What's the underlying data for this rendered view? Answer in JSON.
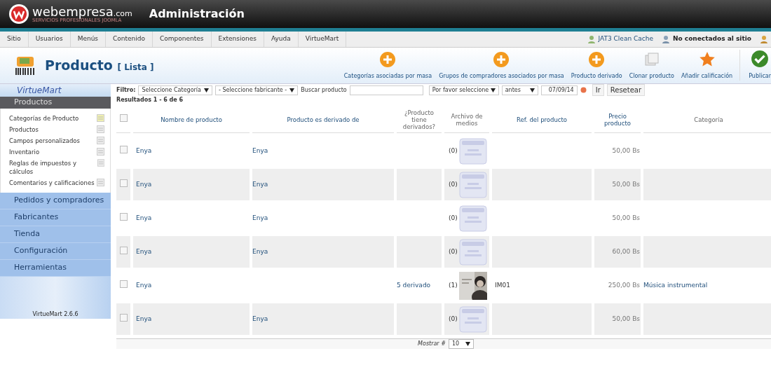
{
  "header": {
    "brand": "webempresa",
    "brand_suffix": ".com",
    "tagline": "SERVICIOS PROFESIONALES JOOMLA",
    "title": "Administración"
  },
  "menu": [
    "Sitio",
    "Usuarios",
    "Menús",
    "Contenido",
    "Componentes",
    "Extensiones",
    "Ayuda",
    "VirtueMart"
  ],
  "status_links": [
    {
      "label": "JAT3 Clean Cache"
    },
    {
      "label": "No conectados al sitio"
    }
  ],
  "page_title": {
    "title": "Producto",
    "subtitle": "[ Lista ]"
  },
  "toolbar": [
    {
      "label": "Categorías asociadas por masa",
      "kind": "add"
    },
    {
      "label": "Grupos de compradores asociados por masa",
      "kind": "add"
    },
    {
      "label": "Producto derivado",
      "kind": "add"
    },
    {
      "label": "Clonar producto",
      "kind": "clone"
    },
    {
      "label": "Añadir calificación",
      "kind": "star"
    },
    {
      "label": "Publicar",
      "kind": "publish"
    }
  ],
  "sidebar": {
    "logo": "VirtueMart",
    "active_section": "Productos",
    "items": [
      "Categorías de Producto",
      "Productos",
      "Campos personalizados",
      "Inventario",
      "Reglas de impuestos y cálculos",
      "Comentarios y calificaciones"
    ],
    "sections": [
      "Pedidos y compradores",
      "Fabricantes",
      "Tienda",
      "Configuración",
      "Herramientas"
    ],
    "version": "VirtueMart 2.6.6"
  },
  "filter": {
    "label": "Filtro:",
    "category": "Seleccione Categoría",
    "manufacturer": "- Seleccione fabricante -",
    "search_label": "Buscar producto",
    "date_option": "Por favor seleccione",
    "when": "antes",
    "date": "07/09/14",
    "go": "Ir",
    "reset": "Resetear"
  },
  "results": "Resultados 1 - 6 de 6",
  "table": {
    "select_all_checked": false,
    "columns": [
      "Nombre de producto",
      "Producto es derivado de",
      "¿Producto tiene derivados?",
      "Archivo de medios",
      "Ref. del producto",
      "Precio producto",
      "Categoría"
    ],
    "rows": [
      {
        "checked": false,
        "name": "Enya",
        "derived_from": "Enya",
        "media": {
          "count": "(0)",
          "kind": "placeholder"
        },
        "price": "50,00 Bs"
      },
      {
        "checked": false,
        "name": "Enya",
        "derived_from": "Enya",
        "media": {
          "count": "(0)",
          "kind": "placeholder"
        },
        "price": "50,00 Bs"
      },
      {
        "checked": false,
        "name": "Enya",
        "derived_from": "Enya",
        "media": {
          "count": "(0)",
          "kind": "placeholder"
        },
        "price": "50,00 Bs"
      },
      {
        "checked": false,
        "name": "Enya",
        "derived_from": "Enya",
        "media": {
          "count": "(0)",
          "kind": "placeholder"
        },
        "price": "60,00 Bs"
      },
      {
        "checked": false,
        "name": "Enya",
        "derivatives": "5 derivado",
        "media": {
          "count": "(1)",
          "kind": "picture"
        },
        "ref": "IM01",
        "price": "250,00 Bs",
        "category": "Música instrumental"
      },
      {
        "checked": false,
        "name": "Enya",
        "derived_from": "Enya",
        "media": {
          "count": "(0)",
          "kind": "placeholder"
        },
        "price": "50,00 Bs"
      }
    ]
  },
  "pagination": {
    "label": "Mostrar #",
    "value": "10"
  }
}
